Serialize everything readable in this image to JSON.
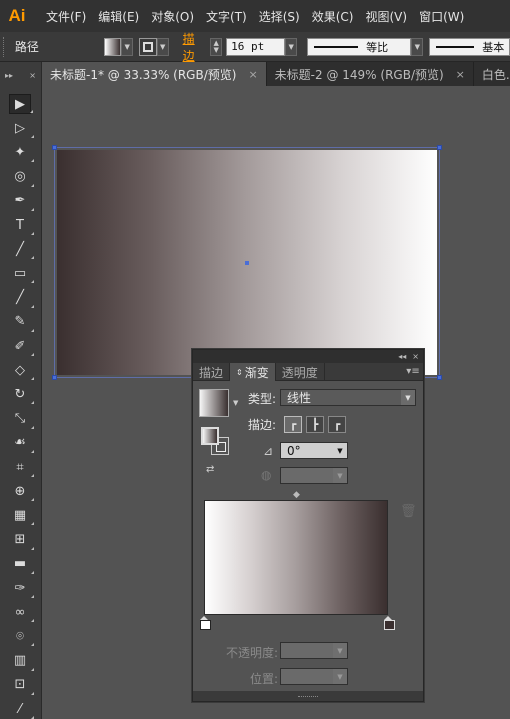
{
  "app": {
    "logo": "Ai"
  },
  "menu": [
    "文件(F)",
    "编辑(E)",
    "对象(O)",
    "文字(T)",
    "选择(S)",
    "效果(C)",
    "视图(V)",
    "窗口(W)"
  ],
  "control_bar": {
    "selection_label": "路径",
    "stroke_label": "描边",
    "stroke_value": "16 pt",
    "profile_label": "等比",
    "brush_label": "基本"
  },
  "doc_tabs": [
    {
      "label": "未标题-1* @ 33.33% (RGB/预览)",
      "close": "×",
      "active": true
    },
    {
      "label": "未标题-2 @ 149% (RGB/预览)",
      "close": "×",
      "active": false
    },
    {
      "label": "白色.a",
      "close": "",
      "active": false
    }
  ],
  "tools": [
    {
      "name": "selection-tool-icon",
      "glyph": "▶",
      "active": true
    },
    {
      "name": "direct-selection-tool-icon",
      "glyph": "▷"
    },
    {
      "name": "magic-wand-tool-icon",
      "glyph": "✦"
    },
    {
      "name": "lasso-tool-icon",
      "glyph": "◎"
    },
    {
      "name": "pen-tool-icon",
      "glyph": "✒"
    },
    {
      "name": "type-tool-icon",
      "glyph": "T"
    },
    {
      "name": "line-tool-icon",
      "glyph": "╱"
    },
    {
      "name": "rectangle-tool-icon",
      "glyph": "▭"
    },
    {
      "name": "paintbrush-tool-icon",
      "glyph": "╱"
    },
    {
      "name": "pencil-tool-icon",
      "glyph": "✎"
    },
    {
      "name": "blob-brush-tool-icon",
      "glyph": "✐"
    },
    {
      "name": "eraser-tool-icon",
      "glyph": "◇"
    },
    {
      "name": "rotate-tool-icon",
      "glyph": "↻"
    },
    {
      "name": "scale-tool-icon",
      "glyph": "⤡"
    },
    {
      "name": "warp-tool-icon",
      "glyph": "☙"
    },
    {
      "name": "free-transform-tool-icon",
      "glyph": "⌗"
    },
    {
      "name": "shape-builder-tool-icon",
      "glyph": "⊕"
    },
    {
      "name": "perspective-grid-tool-icon",
      "glyph": "▦"
    },
    {
      "name": "mesh-tool-icon",
      "glyph": "⊞"
    },
    {
      "name": "gradient-tool-icon",
      "glyph": "▬"
    },
    {
      "name": "eyedropper-tool-icon",
      "glyph": "✑"
    },
    {
      "name": "blend-tool-icon",
      "glyph": "∞"
    },
    {
      "name": "symbol-sprayer-tool-icon",
      "glyph": "⌾"
    },
    {
      "name": "column-graph-tool-icon",
      "glyph": "▥"
    },
    {
      "name": "artboard-tool-icon",
      "glyph": "⊡"
    },
    {
      "name": "slice-tool-icon",
      "glyph": "⁄"
    }
  ],
  "gradient_panel": {
    "tabs": [
      {
        "label": "描边",
        "active": false
      },
      {
        "label": "渐变",
        "active": true
      },
      {
        "label": "透明度",
        "active": false
      }
    ],
    "type_label": "类型:",
    "type_value": "线性",
    "stroke_label": "描边:",
    "angle_value": "0°",
    "aspect_value": "",
    "opacity_label": "不透明度:",
    "location_label": "位置:",
    "stops": [
      {
        "position": 0,
        "color": "#ffffff"
      },
      {
        "position": 100,
        "color": "#3a2f2f"
      }
    ]
  },
  "colors": {
    "accent": "#ff9a00",
    "selection": "#4a6ed6",
    "gradient_start": "#3a2f2f",
    "gradient_end": "#ffffff"
  }
}
